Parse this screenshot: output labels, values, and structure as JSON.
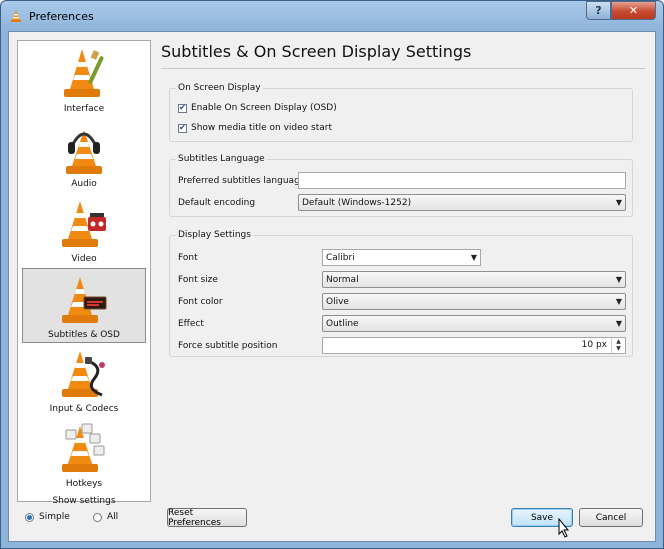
{
  "window": {
    "title": "Preferences",
    "help_button": "?",
    "close_button": "✕"
  },
  "sidebar": {
    "items": [
      {
        "label": "Interface",
        "icon": "vlc-cone-brush-icon"
      },
      {
        "label": "Audio",
        "icon": "vlc-cone-headphones-icon"
      },
      {
        "label": "Video",
        "icon": "vlc-cone-film-icon"
      },
      {
        "label": "Subtitles & OSD",
        "icon": "vlc-cone-subtitles-icon"
      },
      {
        "label": "Input & Codecs",
        "icon": "vlc-cone-cable-icon"
      },
      {
        "label": "Hotkeys",
        "icon": "vlc-cone-keys-icon"
      }
    ],
    "active_index": 3
  },
  "show_settings": {
    "label": "Show settings",
    "simple": "Simple",
    "all": "All",
    "selected": "Simple"
  },
  "page": {
    "title": "Subtitles & On Screen Display Settings",
    "osd": {
      "title": "On Screen Display",
      "enable_osd": "Enable On Screen Display (OSD)",
      "show_media_title": "Show media title on video start",
      "enable_osd_checked": true,
      "show_media_title_checked": true
    },
    "language": {
      "title": "Subtitles Language",
      "preferred_label": "Preferred subtitles language",
      "preferred_value": "",
      "encoding_label": "Default encoding",
      "encoding_value": "Default (Windows-1252)"
    },
    "display": {
      "title": "Display Settings",
      "font_label": "Font",
      "font_value": "Calibri",
      "size_label": "Font size",
      "size_value": "Normal",
      "color_label": "Font color",
      "color_value": "Olive",
      "effect_label": "Effect",
      "effect_value": "Outline",
      "position_label": "Force subtitle position",
      "position_value": "10 px"
    }
  },
  "buttons": {
    "reset": "Reset Preferences",
    "save": "Save",
    "cancel": "Cancel"
  },
  "colors": {
    "titlebar": "#8fb4db",
    "cone_orange": "#f08a13",
    "accent_blue": "#3c7fb1"
  }
}
